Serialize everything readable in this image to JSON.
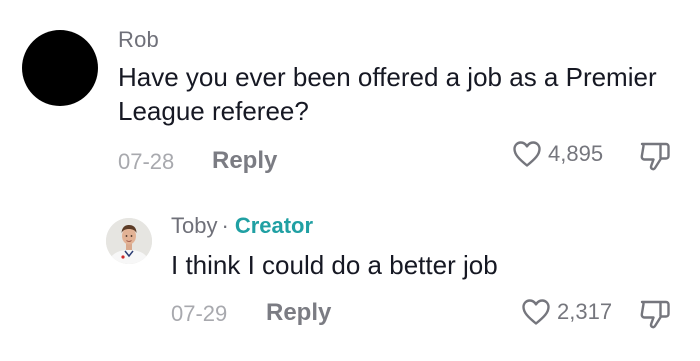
{
  "comment": {
    "username": "Rob",
    "text": "Have you ever been offered a job as a Premier League referee?",
    "date": "07-28",
    "reply_label": "Reply",
    "like_count": "4,895",
    "avatar_color": "#000000"
  },
  "reply": {
    "username": "Toby",
    "separator": "·",
    "badge": "Creator",
    "badge_color": "#20a0a3",
    "text": "I think I could do a better job",
    "date": "07-29",
    "reply_label": "Reply",
    "like_count": "2,317"
  },
  "icons": {
    "like": "heart-outline-icon",
    "dislike": "thumbs-down-outline-icon"
  }
}
